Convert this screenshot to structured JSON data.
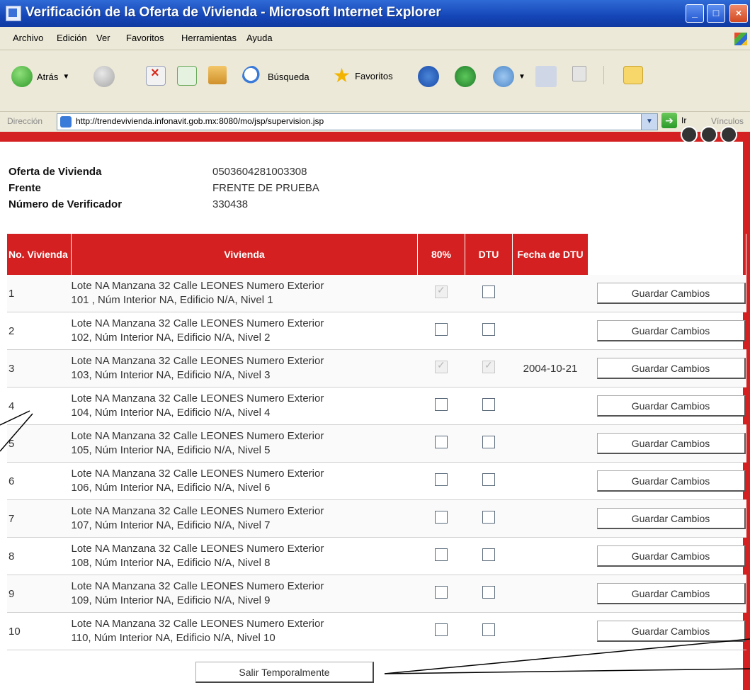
{
  "window": {
    "title": "Verificación de la Oferta de Vivienda - Microsoft Internet Explorer"
  },
  "menu": [
    "Archivo",
    "Edición",
    "Ver",
    "Favoritos",
    "Herramientas",
    "Ayuda"
  ],
  "toolbar": {
    "back_label": "Atrás",
    "search_label": "Búsqueda",
    "favorites_label": "Favoritos"
  },
  "address": {
    "label": "Dirección",
    "url": "http://trendevivienda.infonavit.gob.mx:8080/mo/jsp/supervision.jsp",
    "go_label": "Ir",
    "links_label": "Vínculos"
  },
  "info": {
    "oferta_label": "Oferta de Vivienda",
    "oferta_value": "0503604281003308",
    "frente_label": "Frente",
    "frente_value": "FRENTE DE PRUEBA",
    "verificador_label": "Número de Verificador",
    "verificador_value": "330438"
  },
  "table": {
    "headers": {
      "no": "No. Vivienda",
      "vivienda": "Vivienda",
      "pct": "80%",
      "dtu": "DTU",
      "fecha": "Fecha de DTU"
    },
    "rows": [
      {
        "no": "1",
        "line1": "Lote NA Manzana 32 Calle LEONES Numero Exterior",
        "line2": "101 , Núm Interior NA, Edificio N/A, Nivel 1",
        "pct": true,
        "dtu": false,
        "fecha": "",
        "action": "Guardar Cambios"
      },
      {
        "no": "2",
        "line1": "Lote NA Manzana 32 Calle LEONES Numero Exterior",
        "line2": "102, Núm Interior NA, Edificio N/A, Nivel 2",
        "pct": false,
        "dtu": false,
        "fecha": "",
        "action": "Guardar Cambios"
      },
      {
        "no": "3",
        "line1": "Lote NA Manzana 32 Calle LEONES Numero Exterior",
        "line2": "103, Núm Interior NA, Edificio N/A, Nivel 3",
        "pct": true,
        "dtu": true,
        "fecha": "2004-10-21",
        "action": "Guardar Cambios"
      },
      {
        "no": "4",
        "line1": "Lote NA Manzana 32 Calle LEONES Numero Exterior",
        "line2": "104, Núm Interior NA, Edificio N/A, Nivel 4",
        "pct": false,
        "dtu": false,
        "fecha": "",
        "action": "Guardar Cambios"
      },
      {
        "no": "5",
        "line1": "Lote NA Manzana 32 Calle LEONES Numero Exterior",
        "line2": "105, Núm Interior NA, Edificio N/A, Nivel 5",
        "pct": false,
        "dtu": false,
        "fecha": "",
        "action": "Guardar Cambios"
      },
      {
        "no": "6",
        "line1": "Lote NA Manzana 32 Calle LEONES Numero Exterior",
        "line2": "106, Núm Interior NA, Edificio N/A, Nivel 6",
        "pct": false,
        "dtu": false,
        "fecha": "",
        "action": "Guardar Cambios"
      },
      {
        "no": "7",
        "line1": "Lote NA Manzana 32 Calle LEONES Numero Exterior",
        "line2": "107, Núm Interior NA, Edificio N/A, Nivel 7",
        "pct": false,
        "dtu": false,
        "fecha": "",
        "action": "Guardar Cambios"
      },
      {
        "no": "8",
        "line1": "Lote NA Manzana 32 Calle LEONES Numero Exterior",
        "line2": "108, Núm Interior NA, Edificio N/A, Nivel 8",
        "pct": false,
        "dtu": false,
        "fecha": "",
        "action": "Guardar Cambios"
      },
      {
        "no": "9",
        "line1": "Lote NA Manzana 32 Calle LEONES Numero Exterior",
        "line2": "109, Núm Interior NA, Edificio N/A, Nivel 9",
        "pct": false,
        "dtu": false,
        "fecha": "",
        "action": "Guardar Cambios"
      },
      {
        "no": "10",
        "line1": "Lote NA Manzana 32 Calle LEONES Numero Exterior",
        "line2": "110, Núm Interior NA, Edificio N/A, Nivel 10",
        "pct": false,
        "dtu": false,
        "fecha": "",
        "action": "Guardar Cambios"
      }
    ]
  },
  "exit_label": "Salir Temporalmente",
  "colors": {
    "accent_red": "#d42020",
    "titlebar_blue": "#1546b8",
    "chrome": "#ece9d8"
  }
}
